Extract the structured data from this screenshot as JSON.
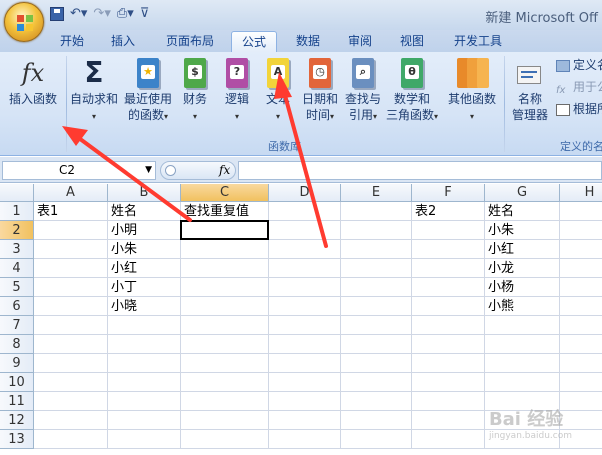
{
  "window": {
    "title": "新建 Microsoft Off",
    "qat_icons": [
      "save-icon",
      "undo-icon",
      "redo-icon",
      "print-preview-icon",
      "customize-icon"
    ]
  },
  "tabs": [
    "开始",
    "插入",
    "页面布局",
    "公式",
    "数据",
    "审阅",
    "视图",
    "开发工具"
  ],
  "active_tab": "公式",
  "ribbon": {
    "insert_function": "插入函数",
    "autosum": "自动求和",
    "recent_1": "最近使用",
    "recent_2": "的函数",
    "finance": "财务",
    "logic": "逻辑",
    "text": "文本",
    "date_1": "日期和",
    "date_2": "时间",
    "lookup_1": "查找与",
    "lookup_2": "引用",
    "math_1": "数学和",
    "math_2": "三角函数",
    "other": "其他函数",
    "group_function_library": "函数库",
    "name_mgr_1": "名称",
    "name_mgr_2": "管理器",
    "define_name": "定义名",
    "use_in_formula": "用于公",
    "create_from_sel": "根据所",
    "group_defined_names": "定义的名"
  },
  "formula_bar": {
    "name_box": "C2",
    "fx": "fx",
    "content": ""
  },
  "columns": [
    "A",
    "B",
    "C",
    "D",
    "E",
    "F",
    "G",
    "H"
  ],
  "rows": [
    "1",
    "2",
    "3",
    "4",
    "5",
    "6",
    "7",
    "8",
    "9",
    "10",
    "11",
    "12",
    "13"
  ],
  "cells": {
    "A1": "表1",
    "B1": "姓名",
    "C1": "查找重复值",
    "B2": "小明",
    "B3": "小朱",
    "B4": "小红",
    "B5": "小丁",
    "B6": "小晓",
    "F1": "表2",
    "G1": "姓名",
    "G2": "小朱",
    "G3": "小红",
    "G4": "小龙",
    "G5": "小杨",
    "G6": "小熊"
  },
  "selected_cell": "C2",
  "watermark": "Bai 经验",
  "watermark_sub": "jingyan.baidu.com",
  "colors": {
    "annotation_arrow": "#ff3b30",
    "ribbon_bg": "#dbe7f7",
    "selected_header": "#f5c96e"
  }
}
